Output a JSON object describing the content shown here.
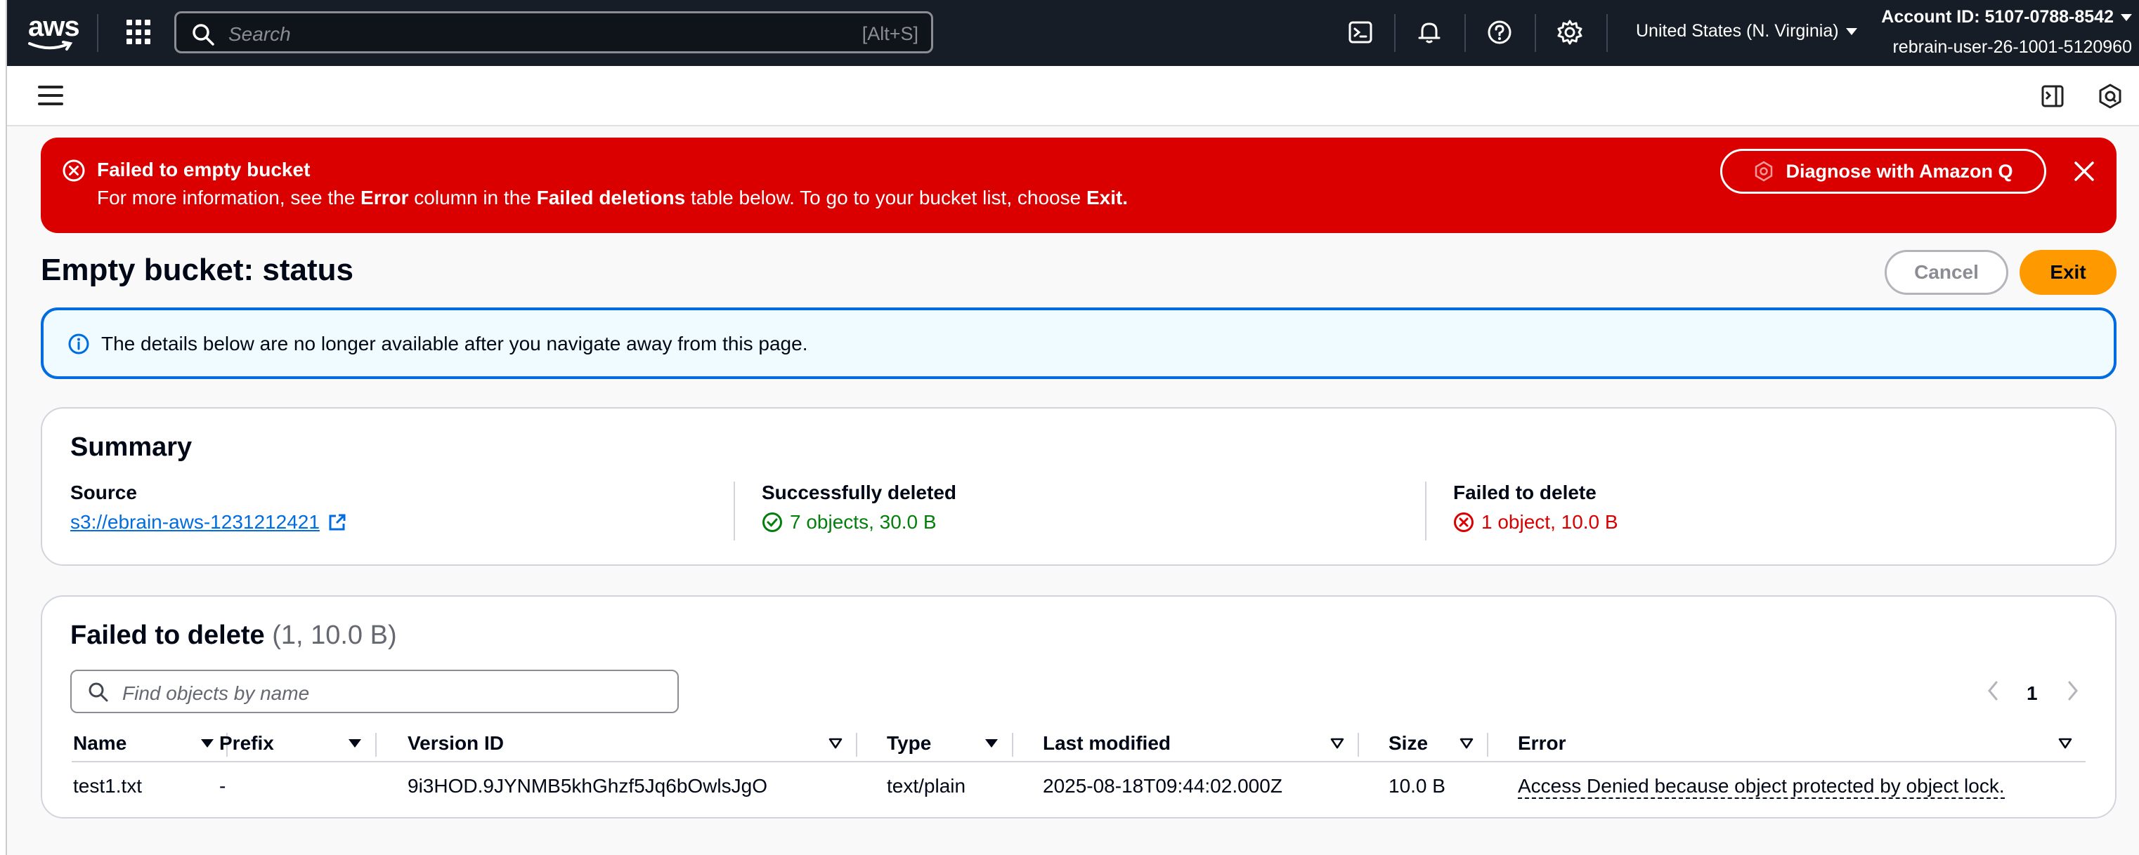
{
  "topnav": {
    "logo_text": "aws",
    "search_placeholder": "Search",
    "search_shortcut": "[Alt+S]",
    "region": "United States (N. Virginia)",
    "account_id": "Account ID: 5107-0788-8542",
    "user": "rebrain-user-26-1001-5120960",
    "icons": [
      "services-grid-icon",
      "search-icon",
      "cloudshell-icon",
      "bell-icon",
      "help-icon",
      "gear-icon"
    ]
  },
  "flash": {
    "title": "Failed to empty bucket",
    "desc_1": "For more information, see the ",
    "desc_error": "Error",
    "desc_2": " column in the ",
    "desc_failed": "Failed deletions",
    "desc_3": " table below. To go to your bucket list, choose ",
    "desc_exit": "Exit.",
    "diagnose_label": "Diagnose with Amazon Q",
    "color": "#db0000"
  },
  "page": {
    "title": "Empty bucket: status",
    "cancel_label": "Cancel",
    "exit_label": "Exit"
  },
  "info": {
    "text": "The details below are no longer available after you navigate away from this page."
  },
  "summary": {
    "title": "Summary",
    "source_label": "Source",
    "source_value": "s3://ebrain-aws-1231212421",
    "success_label": "Successfully deleted",
    "success_value": "7 objects, 30.0 B",
    "failed_label": "Failed to delete",
    "failed_value": "1 object, 10.0 B"
  },
  "failed_table": {
    "title": "Failed to delete",
    "count": "(1, 10.0 B)",
    "search_placeholder": "Find objects by name",
    "page": "1",
    "columns": [
      "Name",
      "Prefix",
      "Version ID",
      "Type",
      "Last modified",
      "Size",
      "Error"
    ],
    "rows": [
      {
        "name": "test1.txt",
        "prefix": "-",
        "version_id": "9i3HOD.9JYNMB5khGhzf5Jq6bOwlsJgO",
        "type": "text/plain",
        "last_modified": "2025-08-18T09:44:02.000Z",
        "size": "10.0 B",
        "error": "Access Denied because object protected by object lock."
      }
    ]
  },
  "colors": {
    "nav_bg": "#161d26",
    "accent": "#ff9900",
    "link": "#006ce0",
    "success": "#037f0c",
    "error": "#db0000"
  }
}
